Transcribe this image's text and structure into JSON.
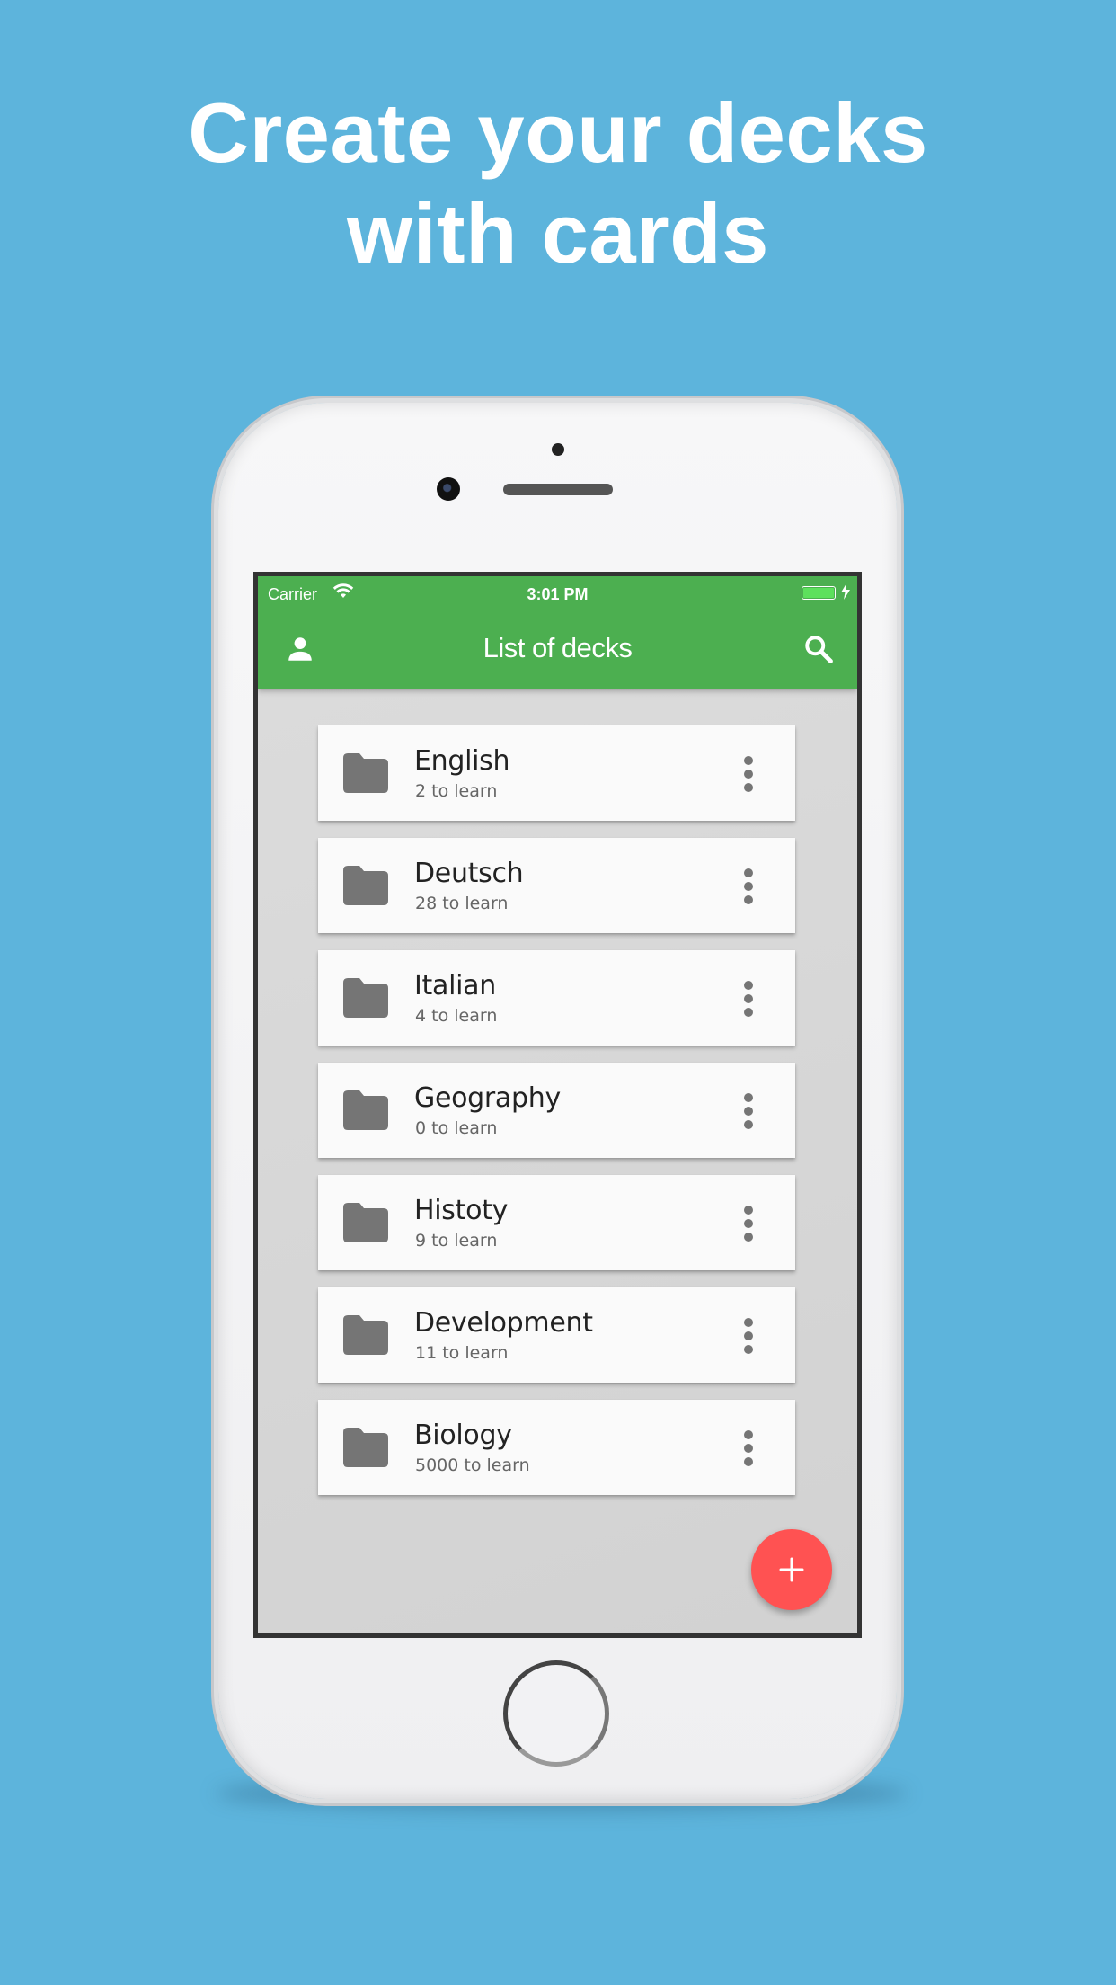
{
  "headline": {
    "line1": "Create your decks",
    "line2": "with cards"
  },
  "status_bar": {
    "carrier": "Carrier",
    "time": "3:01 PM",
    "wifi_icon": "wifi-icon",
    "battery_icon": "battery-icon"
  },
  "app_bar": {
    "title": "List of decks",
    "left_icon": "user-icon",
    "right_icon": "search-icon",
    "color": "#4caf50"
  },
  "decks": [
    {
      "name": "English",
      "count": "2 to learn"
    },
    {
      "name": "Deutsch",
      "count": "28 to learn"
    },
    {
      "name": "Italian",
      "count": "4 to learn"
    },
    {
      "name": "Geography",
      "count": "0 to learn"
    },
    {
      "name": "Histoty",
      "count": "9 to learn"
    },
    {
      "name": "Development",
      "count": "11 to learn"
    },
    {
      "name": "Biology",
      "count": "5000 to learn"
    }
  ],
  "fab": {
    "icon": "plus-icon",
    "color": "#ff5252"
  },
  "colors": {
    "background": "#5db4dc",
    "card": "#fafafa",
    "list_background": "#d8d8d8"
  }
}
